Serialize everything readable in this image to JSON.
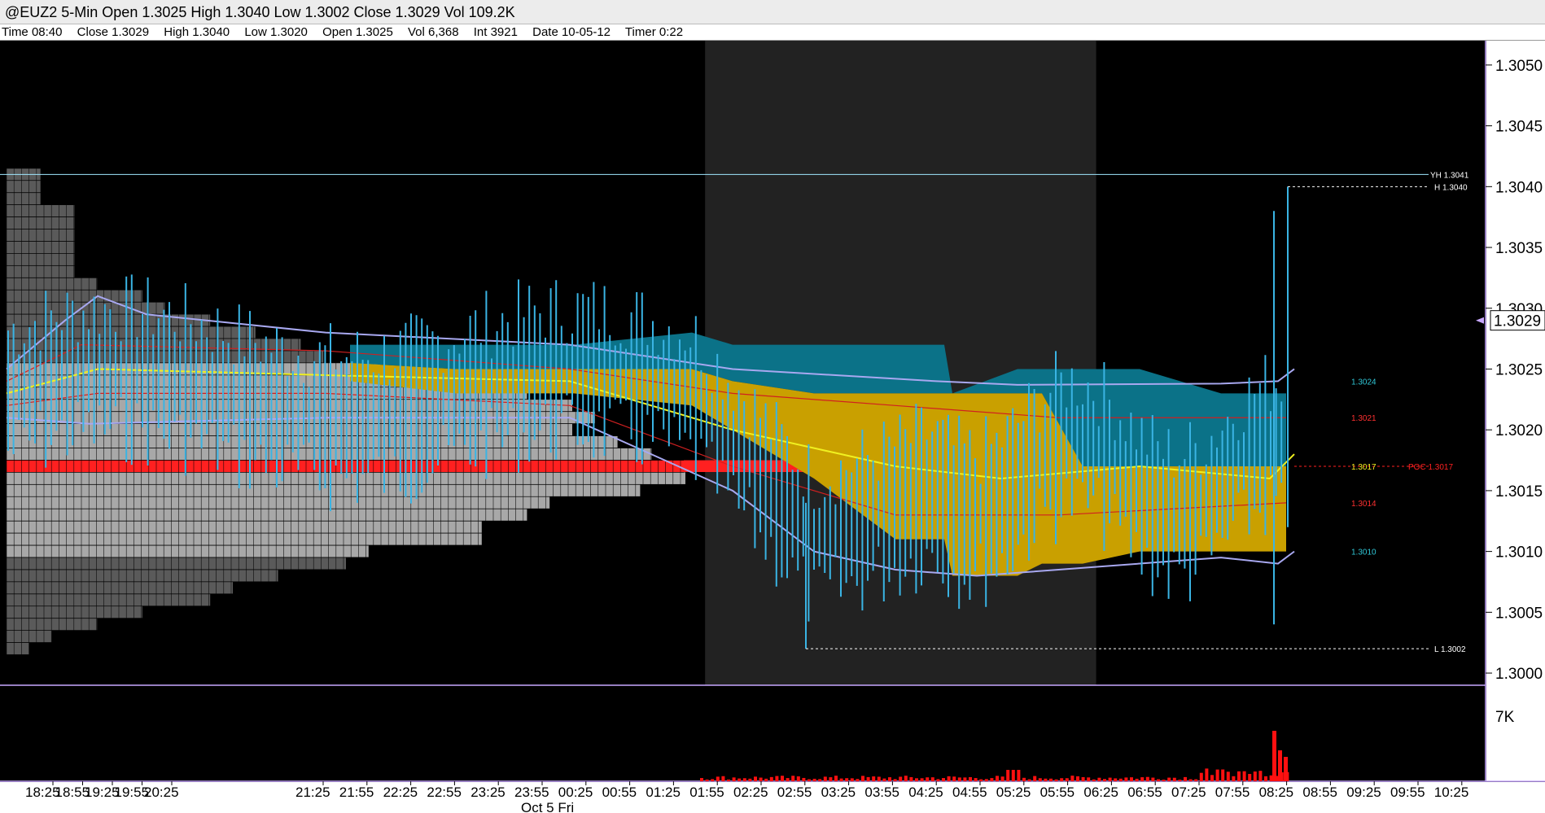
{
  "header": {
    "title": "@EUZ2 5-Min Open 1.3025 High 1.3040 Low 1.3002 Close 1.3029 Vol 109.2K",
    "info": {
      "time": "Time 08:40",
      "close": "Close 1.3029",
      "high": "High 1.3040",
      "low": "Low 1.3020",
      "open": "Open 1.3025",
      "vol": "Vol 6,368",
      "int": "Int 3921",
      "date": "Date 10-05-12",
      "timer": "Timer 0:22"
    }
  },
  "colors": {
    "background": "#000000",
    "session_shade": "#222222",
    "bar": "#3ab4e4",
    "value_area_teal": "#0b7288",
    "value_area_gold": "#c9a000",
    "poc": "#ff2020",
    "upper_band": "#a8a8f0",
    "vwap": "#f0f020",
    "volume": "#ff1010",
    "axis": "#c8a8ff",
    "yesterday_high": "#a0e8ff"
  },
  "chart_data": {
    "type": "bar",
    "subtype": "ohlc-with-market-profile",
    "y_axis": {
      "range": [
        1.2999,
        1.3052
      ],
      "ticks": [
        "1.3050",
        "1.3045",
        "1.3040",
        "1.3035",
        "1.3030",
        "1.3025",
        "1.3020",
        "1.3015",
        "1.3010",
        "1.3005",
        "1.3000"
      ],
      "current_price_label": "1.3029",
      "current_price": 1.3029
    },
    "x_axis": {
      "ticks": [
        "18:25",
        "18:55",
        "19:25",
        "19:55",
        "20:25",
        "21:25",
        "21:55",
        "22:25",
        "22:55",
        "23:25",
        "23:55",
        "00:25",
        "00:55",
        "01:25",
        "01:55",
        "02:25",
        "02:55",
        "03:25",
        "03:55",
        "04:25",
        "04:55",
        "05:25",
        "05:55",
        "06:25",
        "06:55",
        "07:25",
        "07:55",
        "08:25",
        "08:55",
        "09:25",
        "09:55",
        "10:25"
      ],
      "date_label": "Oct 5 Fri"
    },
    "volume_axis_label": "7K",
    "levels": [
      {
        "name": "yesterday-high",
        "label": "YH 1.3041",
        "value": 1.3041
      },
      {
        "name": "high",
        "label": "H 1.3040",
        "value": 1.304
      },
      {
        "name": "low",
        "label": "L 1.3002",
        "value": 1.3002
      },
      {
        "name": "poc",
        "label": "POC 1.3017",
        "value": 1.3017
      }
    ],
    "right_labels": [
      {
        "label": "1.3024",
        "value": 1.3024,
        "color": "#30c8d8"
      },
      {
        "label": "1.3021",
        "value": 1.3021,
        "color": "#ff3030"
      },
      {
        "label": "1.3017",
        "value": 1.3017,
        "color": "#f0f020"
      },
      {
        "label": "1.3014",
        "value": 1.3014,
        "color": "#ff3030"
      },
      {
        "label": "1.3010",
        "value": 1.301,
        "color": "#30c8d8"
      }
    ],
    "session_shade": {
      "from": "01:55",
      "to": "05:55"
    },
    "profile": {
      "tick": 0.0001,
      "top": 1.3041,
      "counts_by_price": [
        [
          1.3041,
          3
        ],
        [
          1.304,
          3
        ],
        [
          1.3039,
          3
        ],
        [
          1.3038,
          6
        ],
        [
          1.3037,
          6
        ],
        [
          1.3036,
          6
        ],
        [
          1.3035,
          6
        ],
        [
          1.3034,
          6
        ],
        [
          1.3033,
          6
        ],
        [
          1.3032,
          8
        ],
        [
          1.3031,
          12
        ],
        [
          1.303,
          14
        ],
        [
          1.3029,
          18
        ],
        [
          1.3028,
          22
        ],
        [
          1.3027,
          26
        ],
        [
          1.3026,
          28
        ],
        [
          1.3025,
          33
        ],
        [
          1.3024,
          40
        ],
        [
          1.3023,
          46
        ],
        [
          1.3022,
          50
        ],
        [
          1.3021,
          52
        ],
        [
          1.302,
          50
        ],
        [
          1.3019,
          54
        ],
        [
          1.3018,
          57
        ],
        [
          1.3017,
          72
        ],
        [
          1.3016,
          60
        ],
        [
          1.3015,
          56
        ],
        [
          1.3014,
          48
        ],
        [
          1.3013,
          46
        ],
        [
          1.3012,
          42
        ],
        [
          1.3011,
          42
        ],
        [
          1.301,
          32
        ],
        [
          1.3009,
          30
        ],
        [
          1.3008,
          24
        ],
        [
          1.3007,
          20
        ],
        [
          1.3006,
          18
        ],
        [
          1.3005,
          12
        ],
        [
          1.3004,
          8
        ],
        [
          1.3003,
          4
        ],
        [
          1.3002,
          2
        ]
      ],
      "value_area": [
        1.301,
        1.3025
      ]
    },
    "series": [
      {
        "name": "bars",
        "type": "ohlc"
      },
      {
        "name": "volume",
        "type": "bar"
      }
    ]
  }
}
